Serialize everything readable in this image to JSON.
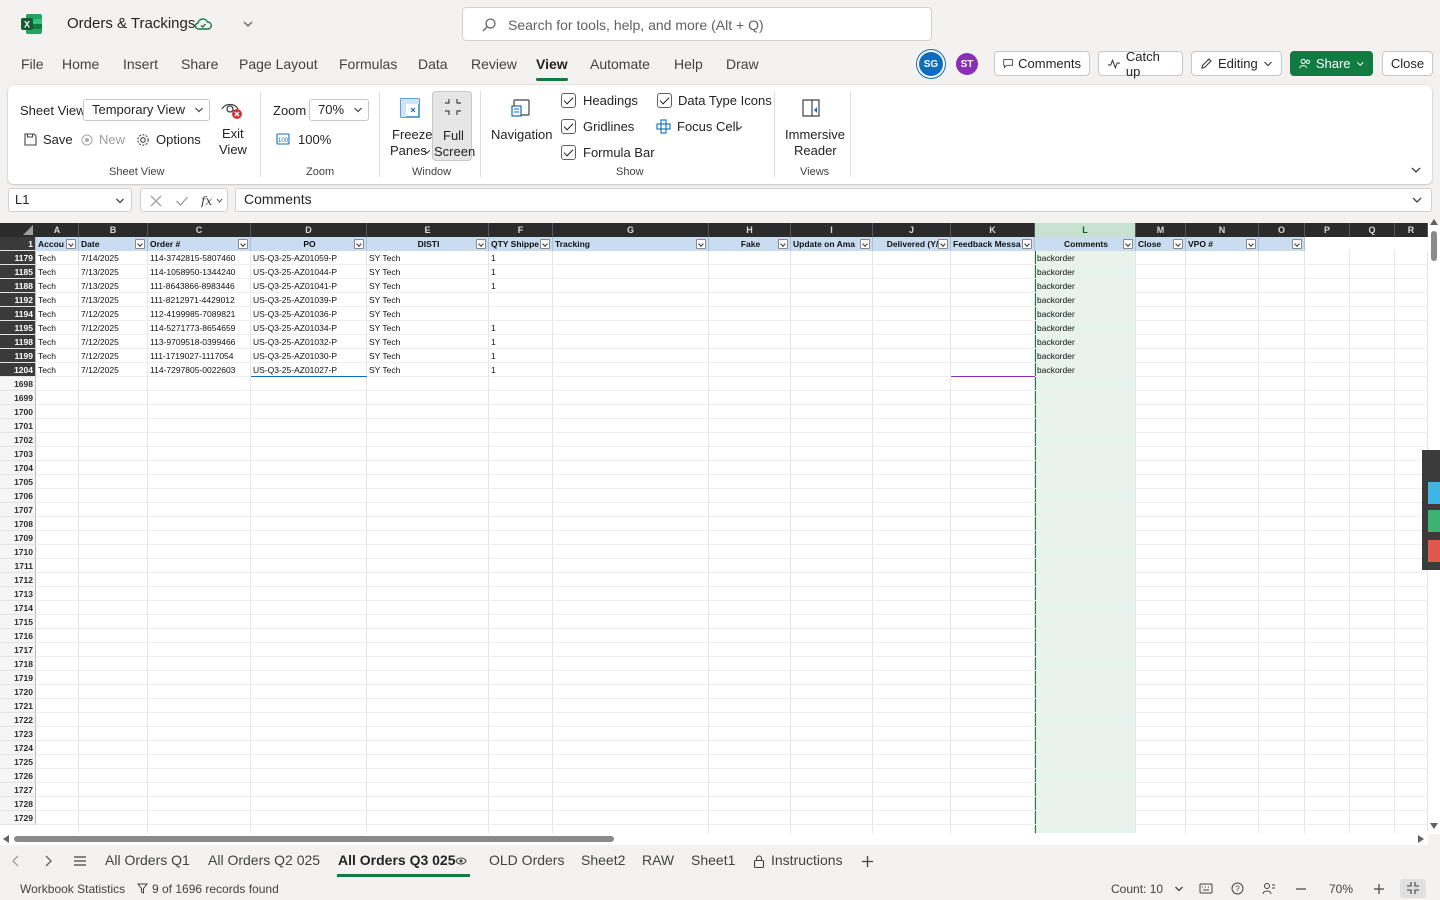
{
  "app": {
    "title": "Orders & Trackings",
    "search_placeholder": "Search for tools, help, and more (Alt + Q)",
    "brand_color": "#107c41"
  },
  "menu": {
    "items": [
      "File",
      "Home",
      "Insert",
      "Share",
      "Page Layout",
      "Formulas",
      "Data",
      "Review",
      "View",
      "Automate",
      "Help",
      "Draw"
    ],
    "active": "View",
    "avatars": [
      "SG",
      "ST"
    ],
    "comments": "Comments",
    "catch_up": "Catch up",
    "editing": "Editing",
    "share": "Share",
    "close": "Close"
  },
  "ribbon": {
    "sheet_view_label": "Sheet View",
    "sheet_view_value": "Temporary View",
    "save": "Save",
    "new": "New",
    "options": "Options",
    "exit_view_1": "Exit",
    "exit_view_2": "View",
    "group_sheet_view": "Sheet View",
    "zoom_label": "Zoom",
    "zoom_value": "70%",
    "zoom_100": "100%",
    "group_zoom": "Zoom",
    "freeze_1": "Freeze",
    "freeze_2": "Panes",
    "full_1": "Full",
    "full_2": "Screen",
    "group_window": "Window",
    "navigation": "Navigation",
    "headings": "Headings",
    "gridlines": "Gridlines",
    "formula_bar": "Formula Bar",
    "data_type_icons": "Data Type Icons",
    "focus_cell": "Focus Cell",
    "group_show": "Show",
    "immersive_1": "Immersive",
    "immersive_2": "Reader",
    "group_views": "Views"
  },
  "formula_bar": {
    "name_box": "L1",
    "formula": "Comments"
  },
  "grid": {
    "columns": [
      "A",
      "B",
      "C",
      "D",
      "E",
      "F",
      "G",
      "H",
      "I",
      "J",
      "K",
      "L",
      "M",
      "N",
      "O",
      "P",
      "Q",
      "R"
    ],
    "headers": [
      "Accou",
      "Date",
      "Order #",
      "PO",
      "DISTI",
      "QTY Shippe",
      "Tracking",
      "Fake",
      "Update on Ama",
      "Delivered (Y/",
      "Feedback Messa",
      "Comments",
      "Close",
      "VPO #",
      ""
    ],
    "rows": [
      {
        "n": "1179",
        "a": "Tech",
        "b": "7/14/2025",
        "c": "114-3742815-5807460",
        "d": "US-Q3-25-AZ01059-P",
        "e": "SY Tech",
        "f": "1",
        "l": "backorder"
      },
      {
        "n": "1185",
        "a": "Tech",
        "b": "7/13/2025",
        "c": "114-1058950-1344240",
        "d": "US-Q3-25-AZ01044-P",
        "e": "SY Tech",
        "f": "1",
        "l": "backorder"
      },
      {
        "n": "1188",
        "a": "Tech",
        "b": "7/13/2025",
        "c": "111-8643866-8983446",
        "d": "US-Q3-25-AZ01041-P",
        "e": "SY Tech",
        "f": "1",
        "l": "backorder"
      },
      {
        "n": "1192",
        "a": "Tech",
        "b": "7/13/2025",
        "c": "111-8212971-4429012",
        "d": "US-Q3-25-AZ01039-P",
        "e": "SY Tech",
        "f": "",
        "l": "backorder"
      },
      {
        "n": "1194",
        "a": "Tech",
        "b": "7/12/2025",
        "c": "112-4199985-7089821",
        "d": "US-Q3-25-AZ01036-P",
        "e": "SY Tech",
        "f": "",
        "l": "backorder"
      },
      {
        "n": "1195",
        "a": "Tech",
        "b": "7/12/2025",
        "c": "114-5271773-8654659",
        "d": "US-Q3-25-AZ01034-P",
        "e": "SY Tech",
        "f": "1",
        "l": "backorder"
      },
      {
        "n": "1198",
        "a": "Tech",
        "b": "7/12/2025",
        "c": "113-9709518-0399466",
        "d": "US-Q3-25-AZ01032-P",
        "e": "SY Tech",
        "f": "1",
        "l": "backorder"
      },
      {
        "n": "1199",
        "a": "Tech",
        "b": "7/12/2025",
        "c": "111-1719027-1117054",
        "d": "US-Q3-25-AZ01030-P",
        "e": "SY Tech",
        "f": "1",
        "l": "backorder"
      },
      {
        "n": "1204",
        "a": "Tech",
        "b": "7/12/2025",
        "c": "114-7297805-0022603",
        "d": "US-Q3-25-AZ01027-P",
        "e": "SY Tech",
        "f": "1",
        "l": "backorder"
      }
    ],
    "empty_rows": [
      "1698",
      "1699",
      "1700",
      "1701",
      "1702",
      "1703",
      "1704",
      "1705",
      "1706",
      "1707",
      "1708",
      "1709",
      "1710",
      "1711",
      "1712",
      "1713",
      "1714",
      "1715",
      "1716",
      "1717",
      "1718",
      "1719",
      "1720",
      "1721",
      "1722",
      "1723",
      "1724",
      "1725",
      "1726",
      "1727",
      "1728",
      "1729"
    ]
  },
  "sheets": {
    "tabs": [
      "All Orders Q1",
      "All Orders Q2 025",
      "All Orders Q3 025",
      "OLD Orders",
      "Sheet2",
      "RAW",
      "Sheet1",
      "Instructions"
    ],
    "active": "All Orders Q3 025"
  },
  "status": {
    "workbook_stats": "Workbook Statistics",
    "filter_info": "9 of 1696 records found",
    "count": "Count: 10",
    "zoom": "70%"
  }
}
